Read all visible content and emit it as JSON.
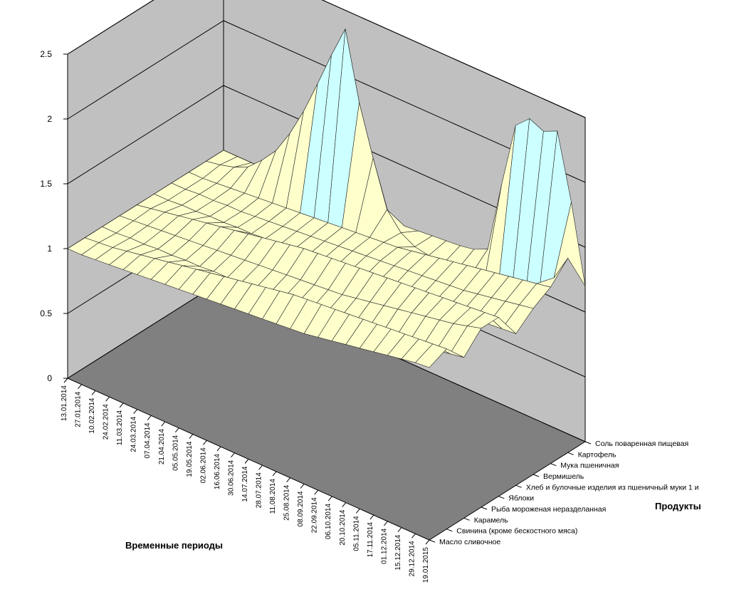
{
  "chart_data": {
    "type": "surface",
    "xlabel": "Временные периоды",
    "zlabel": "Продукты",
    "ylim": [
      0,
      2.5
    ],
    "yticks": [
      "0",
      "0.5",
      "1",
      "1.5",
      "2",
      "2.5"
    ],
    "grid": true,
    "band_colors": {
      "0-0.5": "#cccccc",
      "0.5-1": "#ffffcc",
      "1-1.5": "#ffffcc",
      "1.5-2": "#ccffff",
      "2-2.5": "#660066"
    },
    "wall_color": "#c0c0c0",
    "floor_color": "#808080",
    "periods": [
      "13.01.2014",
      "27.01.2014",
      "10.02.2014",
      "24.02.2014",
      "11.03.2014",
      "24.03.2014",
      "07.04.2014",
      "21.04.2014",
      "05.05.2014",
      "19.05.2014",
      "02.06.2014",
      "16.06.2014",
      "30.06.2014",
      "14.07.2014",
      "28.07.2014",
      "11.08.2014",
      "25.08.2014",
      "08.09.2014",
      "22.09.2014",
      "06.10.2014",
      "20.10.2014",
      "05.11.2014",
      "17.11.2014",
      "01.12.2014",
      "15.12.2014",
      "29.12.2014",
      "19.01.2015"
    ],
    "products": [
      "Масло сливочное",
      "Свинина (кроме бескостного мяса)",
      "Карамель",
      "Рыба мороженая неразделанная",
      "Яблоки",
      "Хлеб и булочные изделия из пшеничный муки 1 и",
      "Вермишель",
      "Мука пшеничная",
      "Картофель",
      "Соль поваренная пищевая"
    ],
    "series": [
      {
        "name": "Масло сливочное",
        "values": [
          1.0,
          1.0,
          1.01,
          1.02,
          1.03,
          1.04,
          1.05,
          1.06,
          1.07,
          1.08,
          1.09,
          1.1,
          1.11,
          1.12,
          1.13,
          1.14,
          1.15,
          1.16,
          1.18,
          1.2,
          1.22,
          1.24,
          1.26,
          1.28,
          1.3,
          1.32,
          1.33
        ]
      },
      {
        "name": "Свинина (кроме бескостного мяса)",
        "values": [
          1.0,
          1.01,
          1.02,
          1.04,
          1.06,
          1.08,
          1.1,
          1.12,
          1.14,
          1.16,
          1.18,
          1.2,
          1.22,
          1.24,
          1.26,
          1.28,
          1.29,
          1.3,
          1.31,
          1.32,
          1.33,
          1.34,
          1.35,
          1.36,
          1.37,
          1.38,
          1.39
        ]
      },
      {
        "name": "Карамель",
        "values": [
          1.0,
          1.0,
          1.01,
          1.01,
          1.02,
          1.02,
          1.03,
          1.03,
          1.04,
          1.04,
          1.05,
          1.05,
          1.06,
          1.07,
          1.08,
          1.08,
          1.09,
          1.1,
          1.1,
          1.11,
          1.12,
          1.14,
          1.16,
          1.18,
          1.2,
          1.22,
          1.24
        ]
      },
      {
        "name": "Рыба мороженая неразделанная",
        "values": [
          1.0,
          1.01,
          1.02,
          1.03,
          1.04,
          1.05,
          1.06,
          1.07,
          1.08,
          1.09,
          1.1,
          1.11,
          1.12,
          1.13,
          1.14,
          1.15,
          1.16,
          1.18,
          1.2,
          1.22,
          1.24,
          1.26,
          1.28,
          1.3,
          1.32,
          1.35,
          1.38
        ]
      },
      {
        "name": "Яблоки",
        "values": [
          1.0,
          1.02,
          1.04,
          1.06,
          1.08,
          1.1,
          1.12,
          1.14,
          1.16,
          1.18,
          1.2,
          1.22,
          1.24,
          1.25,
          1.26,
          1.27,
          1.28,
          1.29,
          1.3,
          1.31,
          1.32,
          1.33,
          1.34,
          1.35,
          1.36,
          1.37,
          1.38
        ]
      },
      {
        "name": "Хлеб и булочные изделия из пшеничный муки 1 и",
        "values": [
          1.0,
          1.0,
          1.01,
          1.01,
          1.02,
          1.02,
          1.03,
          1.03,
          1.04,
          1.04,
          1.05,
          1.05,
          1.06,
          1.06,
          1.07,
          1.07,
          1.08,
          1.08,
          1.09,
          1.1,
          1.11,
          1.12,
          1.13,
          1.14,
          1.15,
          1.16,
          1.17
        ]
      },
      {
        "name": "Вермишель",
        "values": [
          1.0,
          1.0,
          1.01,
          1.01,
          1.02,
          1.02,
          1.03,
          1.04,
          1.05,
          1.06,
          1.07,
          1.08,
          1.09,
          1.1,
          1.11,
          1.12,
          1.13,
          1.14,
          1.15,
          1.16,
          1.17,
          1.18,
          1.2,
          1.22,
          1.24,
          1.26,
          1.28
        ]
      },
      {
        "name": "Мука пшеничная",
        "values": [
          1.0,
          1.0,
          1.01,
          1.02,
          1.03,
          1.04,
          1.05,
          1.06,
          1.07,
          1.08,
          1.09,
          1.1,
          1.11,
          1.12,
          1.13,
          1.14,
          1.16,
          1.18,
          1.2,
          1.22,
          1.24,
          1.26,
          1.28,
          1.3,
          1.32,
          1.34,
          1.36
        ]
      },
      {
        "name": "Картофель",
        "values": [
          1.0,
          1.02,
          1.05,
          1.1,
          1.2,
          1.32,
          1.5,
          1.72,
          1.98,
          2.25,
          2.5,
          1.98,
          1.6,
          1.25,
          1.12,
          1.06,
          1.04,
          1.02,
          1.02,
          1.03,
          1.04,
          1.05,
          1.08,
          1.12,
          1.2,
          1.3,
          1.5
        ]
      },
      {
        "name": "Соль поваренная пищевая",
        "values": [
          1.0,
          1.0,
          1.0,
          1.0,
          1.0,
          1.0,
          1.0,
          1.0,
          1.01,
          1.01,
          1.02,
          1.02,
          1.03,
          1.04,
          1.05,
          1.06,
          1.07,
          1.08,
          1.1,
          1.15,
          1.7,
          2.2,
          2.3,
          2.25,
          2.3,
          1.8,
          1.2
        ]
      }
    ]
  }
}
